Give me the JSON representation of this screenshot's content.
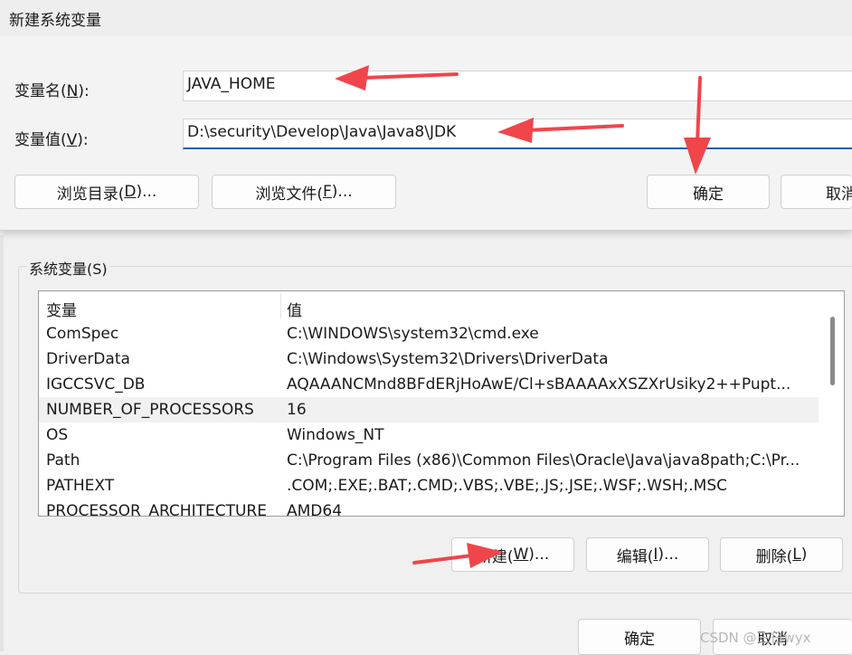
{
  "dialog": {
    "title": "新建系统变量",
    "name_label_pre": "变量名(",
    "name_label_key": "N",
    "name_label_post": "):",
    "name_value": "JAVA_HOME",
    "value_label_pre": "变量值(",
    "value_label_key": "V",
    "value_label_post": "):",
    "value_value": "D:\\security\\Develop\\Java\\Java8\\JDK",
    "browse_dir_pre": "浏览目录(",
    "browse_dir_key": "D",
    "browse_dir_post": ")...",
    "browse_file_pre": "浏览文件(",
    "browse_file_key": "F",
    "browse_file_post": ")...",
    "ok": "确定",
    "cancel_partial": "取消"
  },
  "system_vars": {
    "group_title": "系统变量(S)",
    "col_var": "变量",
    "col_val": "值",
    "rows": [
      {
        "name": "ComSpec",
        "value": "C:\\WINDOWS\\system32\\cmd.exe"
      },
      {
        "name": "DriverData",
        "value": "C:\\Windows\\System32\\Drivers\\DriverData"
      },
      {
        "name": "IGCCSVC_DB",
        "value": "AQAAANCMnd8BFdERjHoAwE/Cl+sBAAAAxXSZXrUsiky2++Pupt..."
      },
      {
        "name": "NUMBER_OF_PROCESSORS",
        "value": "16"
      },
      {
        "name": "OS",
        "value": "Windows_NT"
      },
      {
        "name": "Path",
        "value": "C:\\Program Files (x86)\\Common Files\\Oracle\\Java\\java8path;C:\\Pr..."
      },
      {
        "name": "PATHEXT",
        "value": ".COM;.EXE;.BAT;.CMD;.VBS;.VBE;.JS;.JSE;.WSF;.WSH;.MSC"
      },
      {
        "name": "PROCESSOR_ARCHITECTURE",
        "value": "AMD64"
      }
    ],
    "new_pre": "新建(",
    "new_key": "W",
    "new_post": ")...",
    "edit_pre": "编辑(",
    "edit_key": "I",
    "edit_post": ")...",
    "delete_pre": "删除(",
    "delete_key": "L",
    "delete_post": ")"
  },
  "footer": {
    "ok": "确定",
    "cancel": "取消"
  },
  "watermark": "CSDN @三日wyx",
  "colors": {
    "accent": "#1f5fb5",
    "arrow": "#f0454b"
  }
}
